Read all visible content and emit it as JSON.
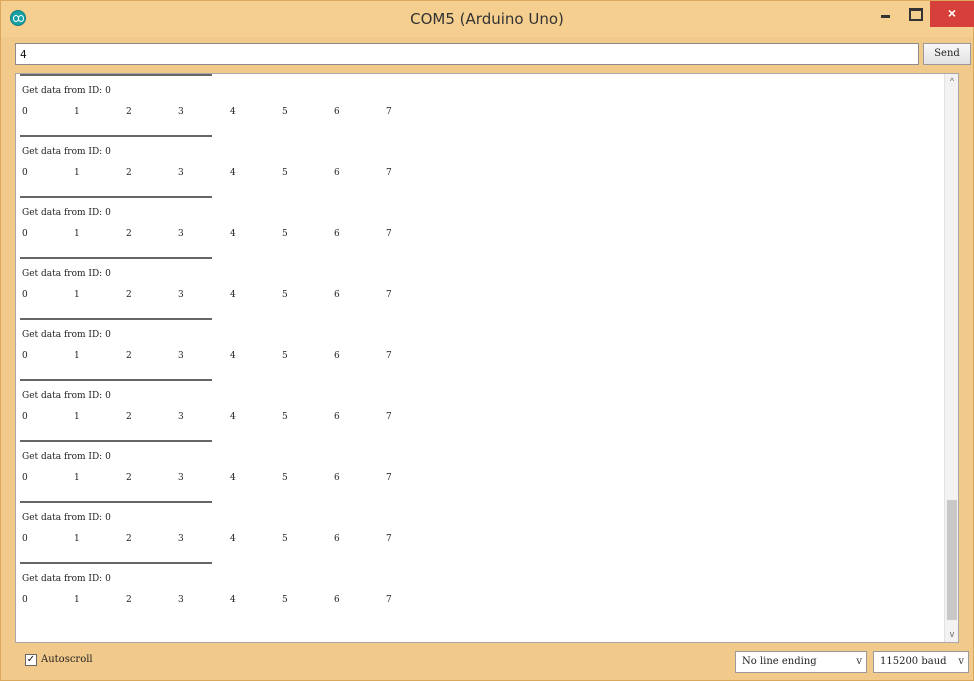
{
  "window": {
    "title": "COM5 (Arduino Uno)"
  },
  "controls": {
    "close_glyph": "×"
  },
  "input": {
    "value": "4",
    "send_label": "Send"
  },
  "output": {
    "header": "Get data from ID: 0",
    "values": [
      "0",
      "1",
      "2",
      "3",
      "4",
      "5",
      "6",
      "7"
    ],
    "block_count": 9
  },
  "scrollbar": {
    "up_glyph": "^",
    "down_glyph": "v"
  },
  "footer": {
    "autoscroll_label": "Autoscroll",
    "autoscroll_checked": true,
    "line_ending": "No line ending",
    "baud": "115200 baud",
    "chevron": "v"
  }
}
